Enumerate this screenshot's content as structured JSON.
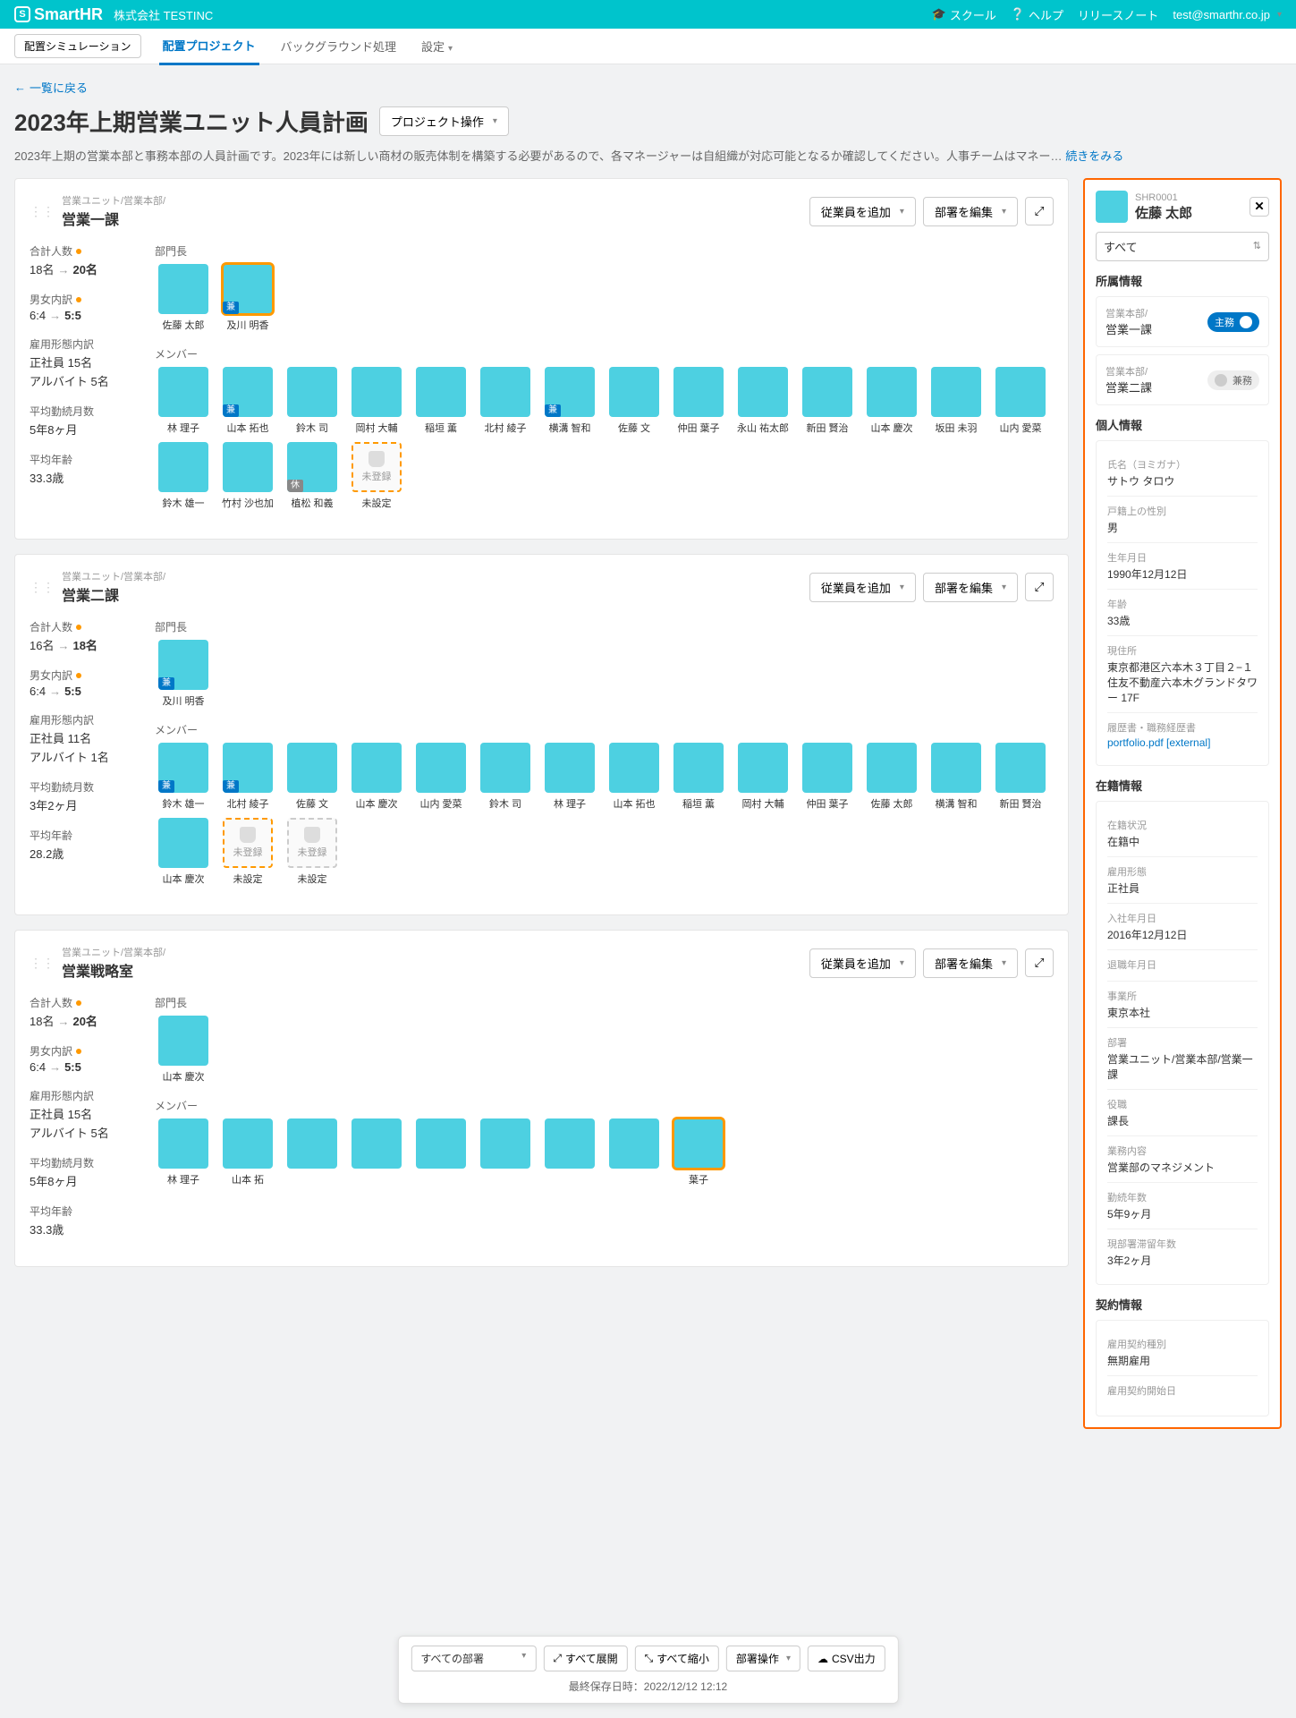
{
  "topbar": {
    "logo": "SmartHR",
    "company": "株式会社 TESTINC",
    "links": {
      "school": "スクール",
      "help": "ヘルプ",
      "release": "リリースノート",
      "user": "test@smarthr.co.jp"
    }
  },
  "nav": {
    "sim": "配置シミュレーション",
    "project": "配置プロジェクト",
    "bg": "バックグラウンド処理",
    "settings": "設定"
  },
  "back_link": "一覧に戻る",
  "page_title": "2023年上期営業ユニット人員計画",
  "project_op_btn": "プロジェクト操作",
  "description": "2023年上期の営業本部と事務本部の人員計画です。2023年には新しい商材の販売体制を構築する必要があるので、各マネージャーは自組織が対応可能となるか確認してください。人事チームはマネー…",
  "more": "続きをみる",
  "labels": {
    "add_employee": "従業員を追加",
    "edit_dept": "部署を編集",
    "head": "部門長",
    "members": "メンバー",
    "total": "合計人数",
    "gender": "男女内訳",
    "employment": "雇用形態内訳",
    "avg_tenure": "平均勤続月数",
    "avg_age": "平均年齢",
    "unregistered": "未登録",
    "unset": "未設定",
    "concurrent": "兼",
    "leave": "休"
  },
  "depts": [
    {
      "path": "営業ユニット/営業本部/",
      "name": "営業一課",
      "stats": {
        "total_from": "18名",
        "total_to": "20名",
        "gender_from": "6:4",
        "gender_to": "5:5",
        "employment": [
          "正社員 15名",
          "アルバイト 5名"
        ],
        "tenure": "5年8ヶ月",
        "age": "33.3歳"
      },
      "heads": [
        {
          "name": "佐藤 太郎"
        },
        {
          "name": "及川 明香",
          "selected": true,
          "badge": "兼"
        }
      ],
      "members": [
        {
          "name": "林 理子"
        },
        {
          "name": "山本 拓也",
          "badge": "兼"
        },
        {
          "name": "鈴木 司"
        },
        {
          "name": "岡村 大輔"
        },
        {
          "name": "稲垣 薫"
        },
        {
          "name": "北村 綾子"
        },
        {
          "name": "横溝 智和",
          "badge": "兼"
        },
        {
          "name": "佐藤 文"
        },
        {
          "name": "仲田 葉子"
        },
        {
          "name": "永山 祐太郎"
        },
        {
          "name": "新田 賢治"
        },
        {
          "name": "山本 慶次"
        },
        {
          "name": "坂田 未羽"
        },
        {
          "name": "山内 愛菜"
        },
        {
          "name": "鈴木 雄一"
        },
        {
          "name": "竹村 沙也加"
        },
        {
          "name": "植松 和義",
          "badge_gray": "休"
        },
        {
          "unassigned": true,
          "orange": true
        }
      ]
    },
    {
      "path": "営業ユニット/営業本部/",
      "name": "営業二課",
      "stats": {
        "total_from": "16名",
        "total_to": "18名",
        "gender_from": "6:4",
        "gender_to": "5:5",
        "employment": [
          "正社員 11名",
          "アルバイト 1名"
        ],
        "tenure": "3年2ヶ月",
        "age": "28.2歳"
      },
      "heads": [
        {
          "name": "及川 明香",
          "badge": "兼"
        }
      ],
      "members": [
        {
          "name": "鈴木 雄一",
          "badge": "兼"
        },
        {
          "name": "北村 綾子",
          "badge": "兼"
        },
        {
          "name": "佐藤 文"
        },
        {
          "name": "山本 慶次"
        },
        {
          "name": "山内 愛菜"
        },
        {
          "name": "鈴木 司"
        },
        {
          "name": "林 理子"
        },
        {
          "name": "山本 拓也"
        },
        {
          "name": "稲垣 薫"
        },
        {
          "name": "岡村 大輔"
        },
        {
          "name": "仲田 葉子"
        },
        {
          "name": "佐藤 太郎"
        },
        {
          "name": "横溝 智和"
        },
        {
          "name": "新田 賢治"
        },
        {
          "name": "山本 慶次"
        },
        {
          "unassigned": true,
          "orange": true
        },
        {
          "unassigned": true
        }
      ]
    },
    {
      "path": "営業ユニット/営業本部/",
      "name": "営業戦略室",
      "stats": {
        "total_from": "18名",
        "total_to": "20名",
        "gender_from": "6:4",
        "gender_to": "5:5",
        "employment": [
          "正社員 15名",
          "アルバイト 5名"
        ],
        "tenure": "5年8ヶ月",
        "age": "33.3歳"
      },
      "heads": [
        {
          "name": "山本 慶次"
        }
      ],
      "members": [
        {
          "name": "林 理子"
        },
        {
          "name": "山本 拓"
        },
        {
          "name": ""
        },
        {
          "name": ""
        },
        {
          "name": ""
        },
        {
          "name": ""
        },
        {
          "name": ""
        },
        {
          "name": ""
        },
        {
          "name": "葉子",
          "selected": true
        }
      ]
    }
  ],
  "bottom_toolbar": {
    "dept_filter": "すべての部署",
    "expand_all": "すべて展開",
    "collapse_all": "すべて縮小",
    "dept_op": "部署操作",
    "csv": "CSV出力",
    "last_saved": "最終保存日時：2022/12/12 12:12"
  },
  "side_panel": {
    "id": "SHR0001",
    "name": "佐藤 太郎",
    "filter": "すべて",
    "affiliation_title": "所属情報",
    "affiliations": [
      {
        "path": "営業本部/",
        "name": "営業一課",
        "badge": "主務",
        "primary": true
      },
      {
        "path": "営業本部/",
        "name": "営業二課",
        "badge": "兼務",
        "primary": false
      }
    ],
    "personal_title": "個人情報",
    "personal": [
      {
        "label": "氏名（ヨミガナ）",
        "value": "サトウ タロウ"
      },
      {
        "label": "戸籍上の性別",
        "value": "男"
      },
      {
        "label": "生年月日",
        "value": "1990年12月12日"
      },
      {
        "label": "年齢",
        "value": "33歳"
      },
      {
        "label": "現住所",
        "value": "東京都港区六本木３丁目２−１ 住友不動産六本木グランドタワー 17F"
      },
      {
        "label": "履歴書・職務経歴書",
        "value": "portfolio.pdf [external]",
        "link": true
      }
    ],
    "enrollment_title": "在籍情報",
    "enrollment": [
      {
        "label": "在籍状況",
        "value": "在籍中"
      },
      {
        "label": "雇用形態",
        "value": "正社員"
      },
      {
        "label": "入社年月日",
        "value": "2016年12月12日"
      },
      {
        "label": "退職年月日",
        "value": ""
      },
      {
        "label": "事業所",
        "value": "東京本社"
      },
      {
        "label": "部署",
        "value": "営業ユニット/営業本部/営業一課"
      },
      {
        "label": "役職",
        "value": "課長"
      },
      {
        "label": "業務内容",
        "value": "営業部のマネジメント"
      },
      {
        "label": "勤続年数",
        "value": "5年9ヶ月"
      },
      {
        "label": "現部署滞留年数",
        "value": "3年2ヶ月"
      }
    ],
    "contract_title": "契約情報",
    "contract": [
      {
        "label": "雇用契約種別",
        "value": "無期雇用"
      },
      {
        "label": "雇用契約開始日",
        "value": ""
      }
    ]
  }
}
